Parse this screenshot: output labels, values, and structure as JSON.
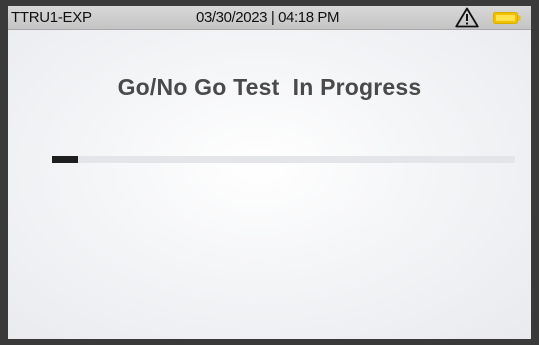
{
  "status_bar": {
    "device_name": "TTRU1-EXP",
    "datetime": "03/30/2023 | 04:18 PM",
    "warning_icon": "warning-triangle-icon",
    "battery_icon": "battery-icon",
    "battery_color": "#f2c200"
  },
  "main": {
    "title": "Go/No Go Test  In Progress",
    "title_color": "#4a4a4a",
    "progress": {
      "fraction": 0.056,
      "fill_color": "#1e1e1e",
      "track_color": "#e4e5e8"
    }
  }
}
